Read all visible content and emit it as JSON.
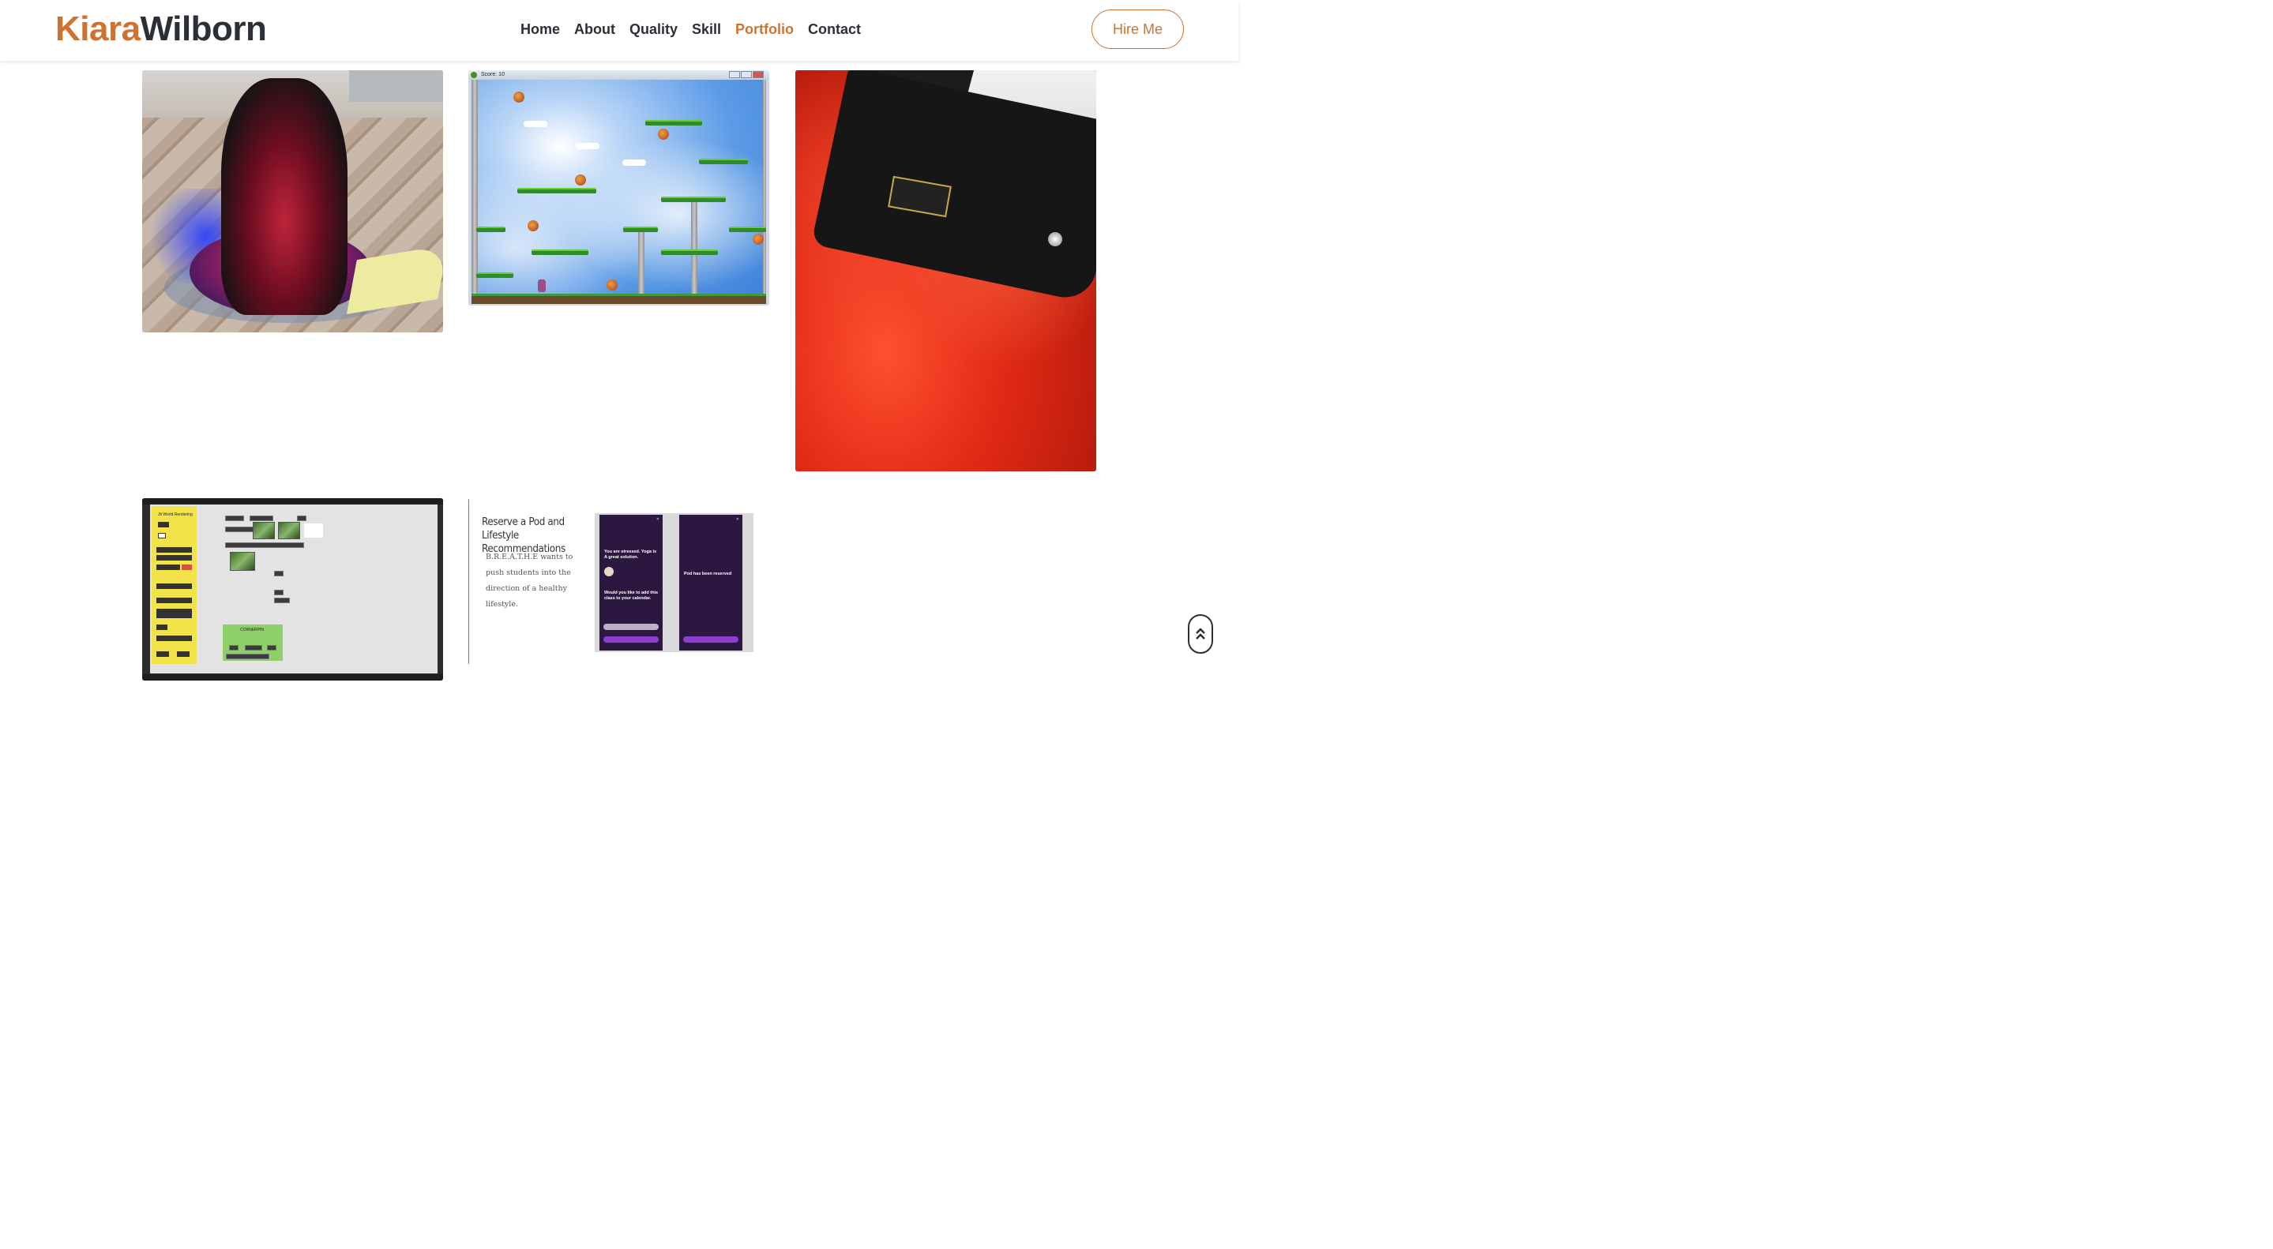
{
  "brand": {
    "first": "Kiara",
    "last": "Wilborn"
  },
  "nav": {
    "items": [
      {
        "label": "Home",
        "active": false
      },
      {
        "label": "About",
        "active": false
      },
      {
        "label": "Quality",
        "active": false
      },
      {
        "label": "Skill",
        "active": false
      },
      {
        "label": "Portfolio",
        "active": true
      },
      {
        "label": "Contact",
        "active": false
      }
    ]
  },
  "hire_button": {
    "label": "Hire Me"
  },
  "portfolio": {
    "game": {
      "window_title": "Score: 10"
    },
    "patch": {
      "sidebar_title": "Jit World Rendering",
      "cornerpin_label": "CORNERPIN"
    },
    "breathe": {
      "heading": "Reserve a Pod and Lifestyle Recommendations",
      "description": "B.R.E.A.T.H.E wants to push students into the direction of a healthy lifestyle.",
      "phone1_text": "You are stressed. Yoga is A great solution.",
      "phone1_question": "Would you like to add this class to your calendar.",
      "phone2_text": "Pod has been reserved"
    }
  },
  "colors": {
    "accent": "#cd7332",
    "text_dark": "#2b3036"
  },
  "icons": {
    "back_to_top": "double-chevron-up-icon"
  }
}
